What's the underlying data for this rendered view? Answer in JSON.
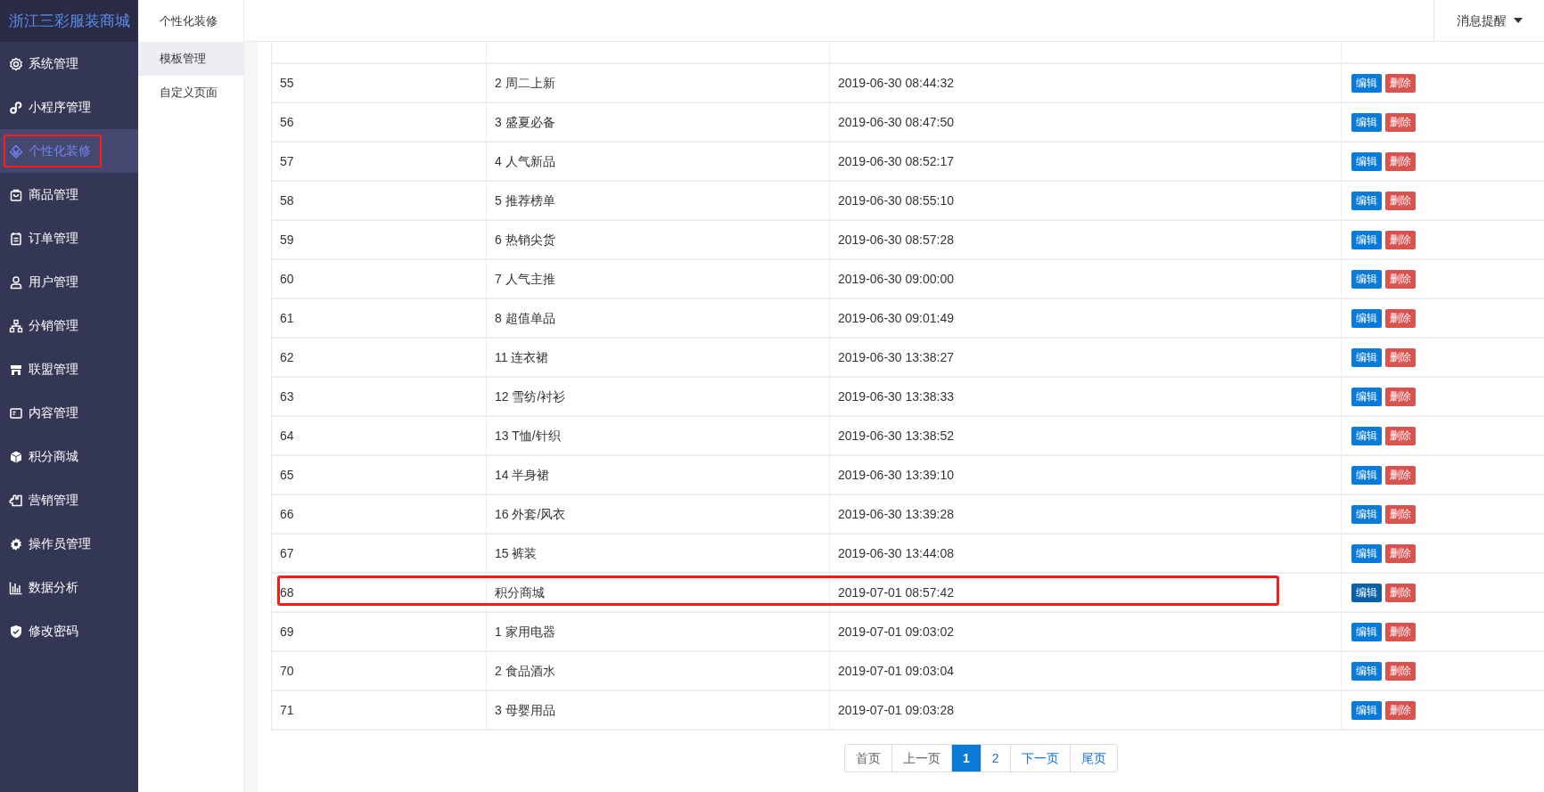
{
  "app": {
    "title": "浙江三彩服装商城"
  },
  "sidebar": {
    "items": [
      {
        "label": "系统管理",
        "selected": false,
        "highlighted": false
      },
      {
        "label": "小程序管理",
        "selected": false,
        "highlighted": false
      },
      {
        "label": "个性化装修",
        "selected": true,
        "highlighted": true
      },
      {
        "label": "商品管理",
        "selected": false,
        "highlighted": false
      },
      {
        "label": "订单管理",
        "selected": false,
        "highlighted": false
      },
      {
        "label": "用户管理",
        "selected": false,
        "highlighted": false
      },
      {
        "label": "分销管理",
        "selected": false,
        "highlighted": false
      },
      {
        "label": "联盟管理",
        "selected": false,
        "highlighted": false
      },
      {
        "label": "内容管理",
        "selected": false,
        "highlighted": false
      },
      {
        "label": "积分商城",
        "selected": false,
        "highlighted": false
      },
      {
        "label": "营销管理",
        "selected": false,
        "highlighted": false
      },
      {
        "label": "操作员管理",
        "selected": false,
        "highlighted": false
      },
      {
        "label": "数据分析",
        "selected": false,
        "highlighted": false
      },
      {
        "label": "修改密码",
        "selected": false,
        "highlighted": false
      }
    ]
  },
  "subnav": {
    "title": "个性化装修",
    "items": [
      {
        "label": "模板管理",
        "selected": true
      },
      {
        "label": "自定义页面",
        "selected": false
      }
    ]
  },
  "header": {
    "notice": "消息提醒"
  },
  "table": {
    "rows": [
      {
        "id": "55",
        "name": "2 周二上新",
        "time": "2019-06-30 08:44:32",
        "highlighted": false,
        "edit": "编辑",
        "delete": "删除",
        "edit_hovered": false
      },
      {
        "id": "56",
        "name": "3 盛夏必备",
        "time": "2019-06-30 08:47:50",
        "highlighted": false,
        "edit": "编辑",
        "delete": "删除",
        "edit_hovered": false
      },
      {
        "id": "57",
        "name": "4 人气新品",
        "time": "2019-06-30 08:52:17",
        "highlighted": false,
        "edit": "编辑",
        "delete": "删除",
        "edit_hovered": false
      },
      {
        "id": "58",
        "name": "5 推荐榜单",
        "time": "2019-06-30 08:55:10",
        "highlighted": false,
        "edit": "编辑",
        "delete": "删除",
        "edit_hovered": false
      },
      {
        "id": "59",
        "name": "6 热销尖货",
        "time": "2019-06-30 08:57:28",
        "highlighted": false,
        "edit": "编辑",
        "delete": "删除",
        "edit_hovered": false
      },
      {
        "id": "60",
        "name": "7 人气主推",
        "time": "2019-06-30 09:00:00",
        "highlighted": false,
        "edit": "编辑",
        "delete": "删除",
        "edit_hovered": false
      },
      {
        "id": "61",
        "name": "8 超值单品",
        "time": "2019-06-30 09:01:49",
        "highlighted": false,
        "edit": "编辑",
        "delete": "删除",
        "edit_hovered": false
      },
      {
        "id": "62",
        "name": "11 连衣裙",
        "time": "2019-06-30 13:38:27",
        "highlighted": false,
        "edit": "编辑",
        "delete": "删除",
        "edit_hovered": false
      },
      {
        "id": "63",
        "name": "12 雪纺/衬衫",
        "time": "2019-06-30 13:38:33",
        "highlighted": false,
        "edit": "编辑",
        "delete": "删除",
        "edit_hovered": false
      },
      {
        "id": "64",
        "name": "13 T恤/针织",
        "time": "2019-06-30 13:38:52",
        "highlighted": false,
        "edit": "编辑",
        "delete": "删除",
        "edit_hovered": false
      },
      {
        "id": "65",
        "name": "14 半身裙",
        "time": "2019-06-30 13:39:10",
        "highlighted": false,
        "edit": "编辑",
        "delete": "删除",
        "edit_hovered": false
      },
      {
        "id": "66",
        "name": "16 外套/风衣",
        "time": "2019-06-30 13:39:28",
        "highlighted": false,
        "edit": "编辑",
        "delete": "删除",
        "edit_hovered": false
      },
      {
        "id": "67",
        "name": "15 裤装",
        "time": "2019-06-30 13:44:08",
        "highlighted": false,
        "edit": "编辑",
        "delete": "删除",
        "edit_hovered": false
      },
      {
        "id": "68",
        "name": "积分商城",
        "time": "2019-07-01 08:57:42",
        "highlighted": true,
        "edit": "编辑",
        "delete": "删除",
        "edit_hovered": true
      },
      {
        "id": "69",
        "name": "1 家用电器",
        "time": "2019-07-01 09:03:02",
        "highlighted": false,
        "edit": "编辑",
        "delete": "删除",
        "edit_hovered": false
      },
      {
        "id": "70",
        "name": "2 食品酒水",
        "time": "2019-07-01 09:03:04",
        "highlighted": false,
        "edit": "编辑",
        "delete": "删除",
        "edit_hovered": false
      },
      {
        "id": "71",
        "name": "3 母婴用品",
        "time": "2019-07-01 09:03:28",
        "highlighted": false,
        "edit": "编辑",
        "delete": "删除",
        "edit_hovered": false
      }
    ]
  },
  "pagination": {
    "items": [
      {
        "label": "首页",
        "selected": false,
        "enabled": false
      },
      {
        "label": "上一页",
        "selected": false,
        "enabled": false
      },
      {
        "label": "1",
        "selected": true,
        "enabled": true
      },
      {
        "label": "2",
        "selected": false,
        "enabled": true
      },
      {
        "label": "下一页",
        "selected": false,
        "enabled": true
      },
      {
        "label": "尾页",
        "selected": false,
        "enabled": true
      }
    ]
  }
}
